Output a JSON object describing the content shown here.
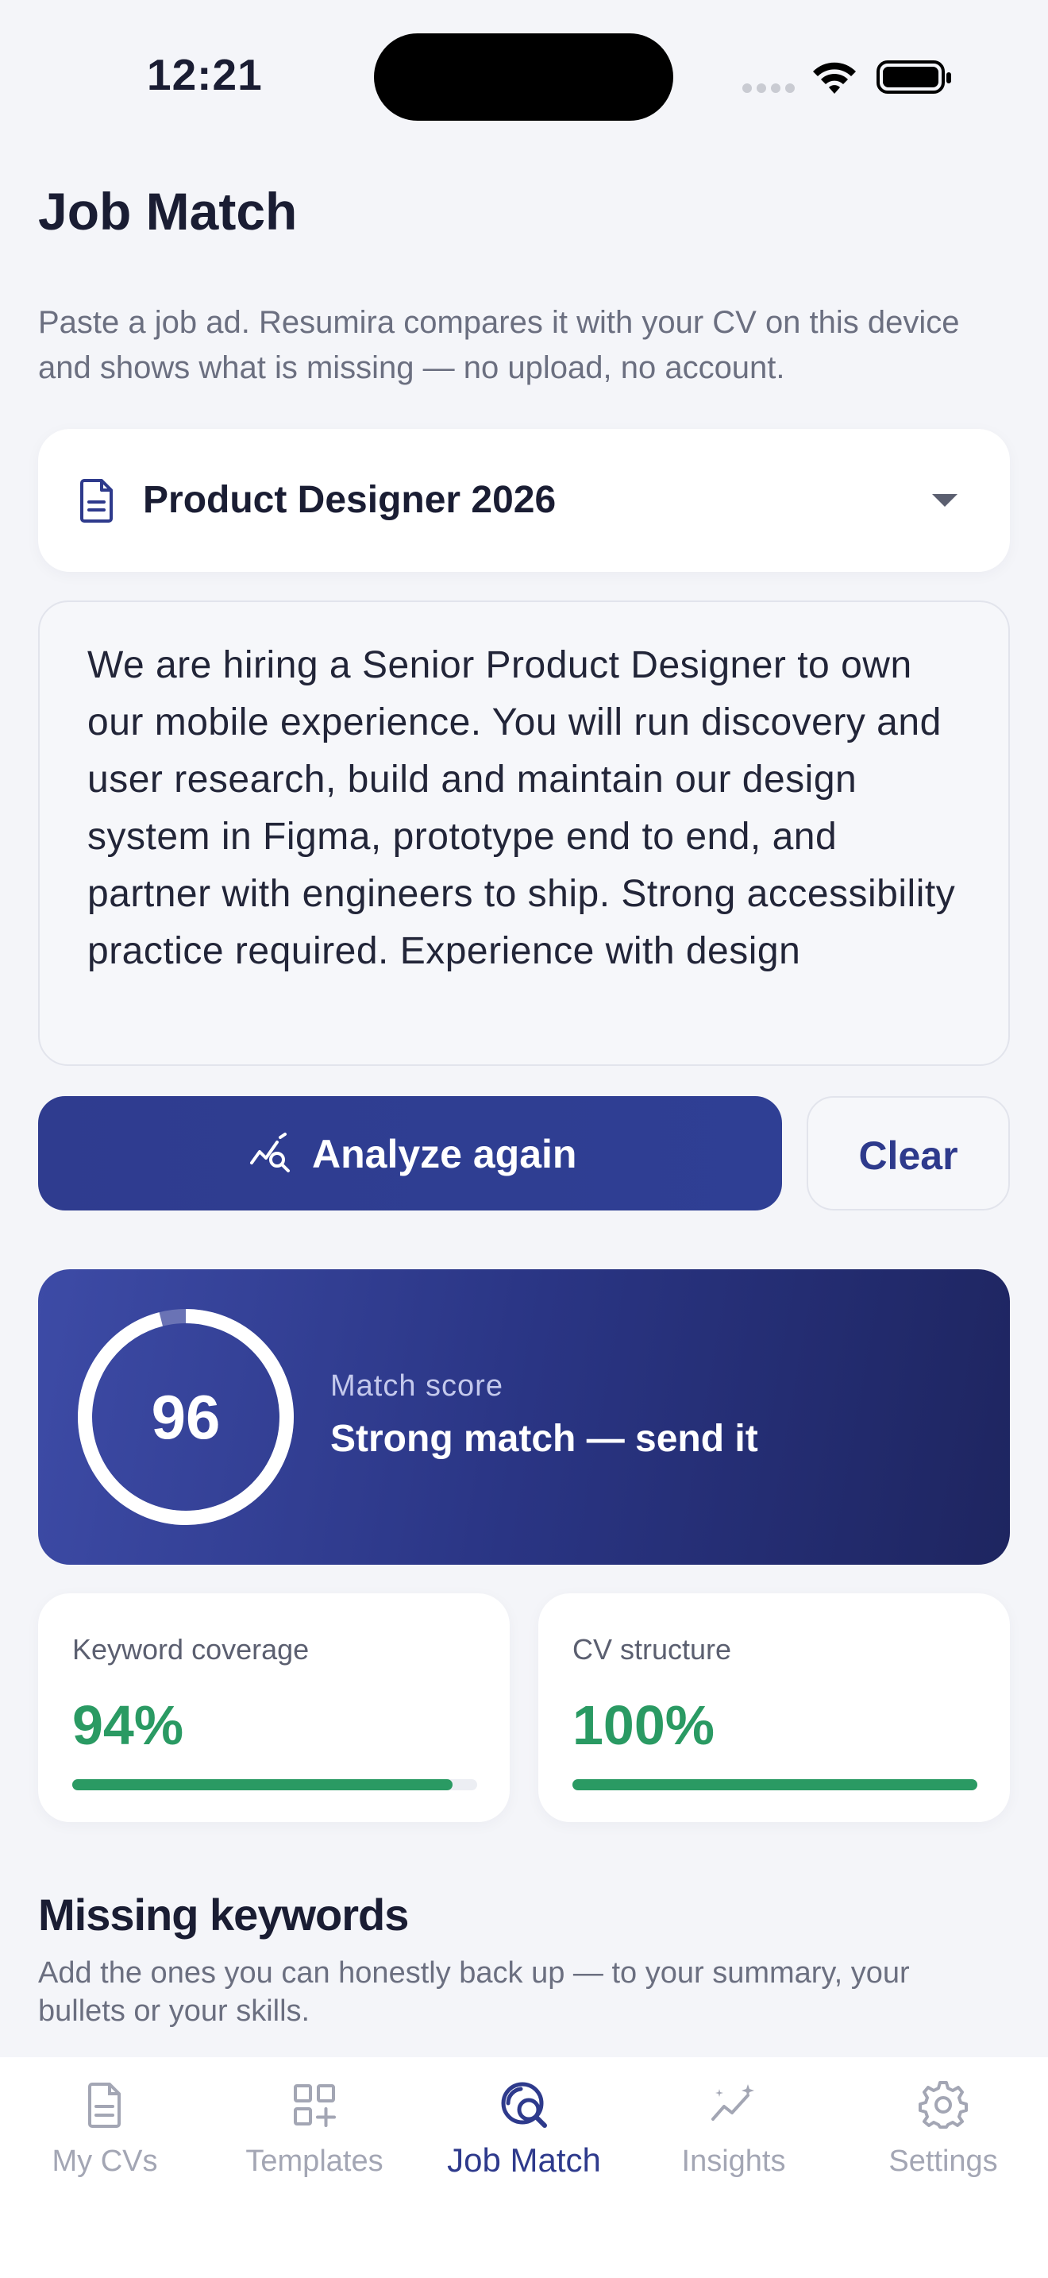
{
  "status_bar": {
    "time": "12:21"
  },
  "page": {
    "title": "Job Match",
    "subtitle": "Paste a job ad. Resumira compares it with your CV on this device and shows what is missing — no upload, no account."
  },
  "cv_selector": {
    "selected": "Product Designer 2026",
    "icon": "document-icon"
  },
  "job_ad": {
    "text": "We are hiring a Senior Product Designer to own our mobile experience. You will run discovery and user research, build and maintain our design system in Figma, prototype end to end, and partner with engineers to ship. Strong accessibility practice required. Experience with design"
  },
  "actions": {
    "analyze_label": "Analyze again",
    "clear_label": "Clear"
  },
  "score": {
    "value": "96",
    "percent": 96,
    "label": "Match score",
    "verdict": "Strong match — send it"
  },
  "metrics": {
    "keyword_coverage": {
      "label": "Keyword coverage",
      "value": "94%",
      "percent": 94
    },
    "cv_structure": {
      "label": "CV structure",
      "value": "100%",
      "percent": 100
    }
  },
  "missing_keywords": {
    "title": "Missing keywords",
    "subtitle": "Add the ones you can honestly back up — to your summary, your bullets or your skills."
  },
  "tab_bar": {
    "items": [
      {
        "label": "My CVs",
        "icon": "document-icon",
        "active": false
      },
      {
        "label": "Templates",
        "icon": "grid-plus-icon",
        "active": false
      },
      {
        "label": "Job Match",
        "icon": "search-match-icon",
        "active": true
      },
      {
        "label": "Insights",
        "icon": "sparkle-chart-icon",
        "active": false
      },
      {
        "label": "Settings",
        "icon": "gear-icon",
        "active": false
      }
    ]
  },
  "colors": {
    "accent": "#2e3a8c",
    "success": "#2a9a63",
    "background": "#f4f5f9"
  }
}
